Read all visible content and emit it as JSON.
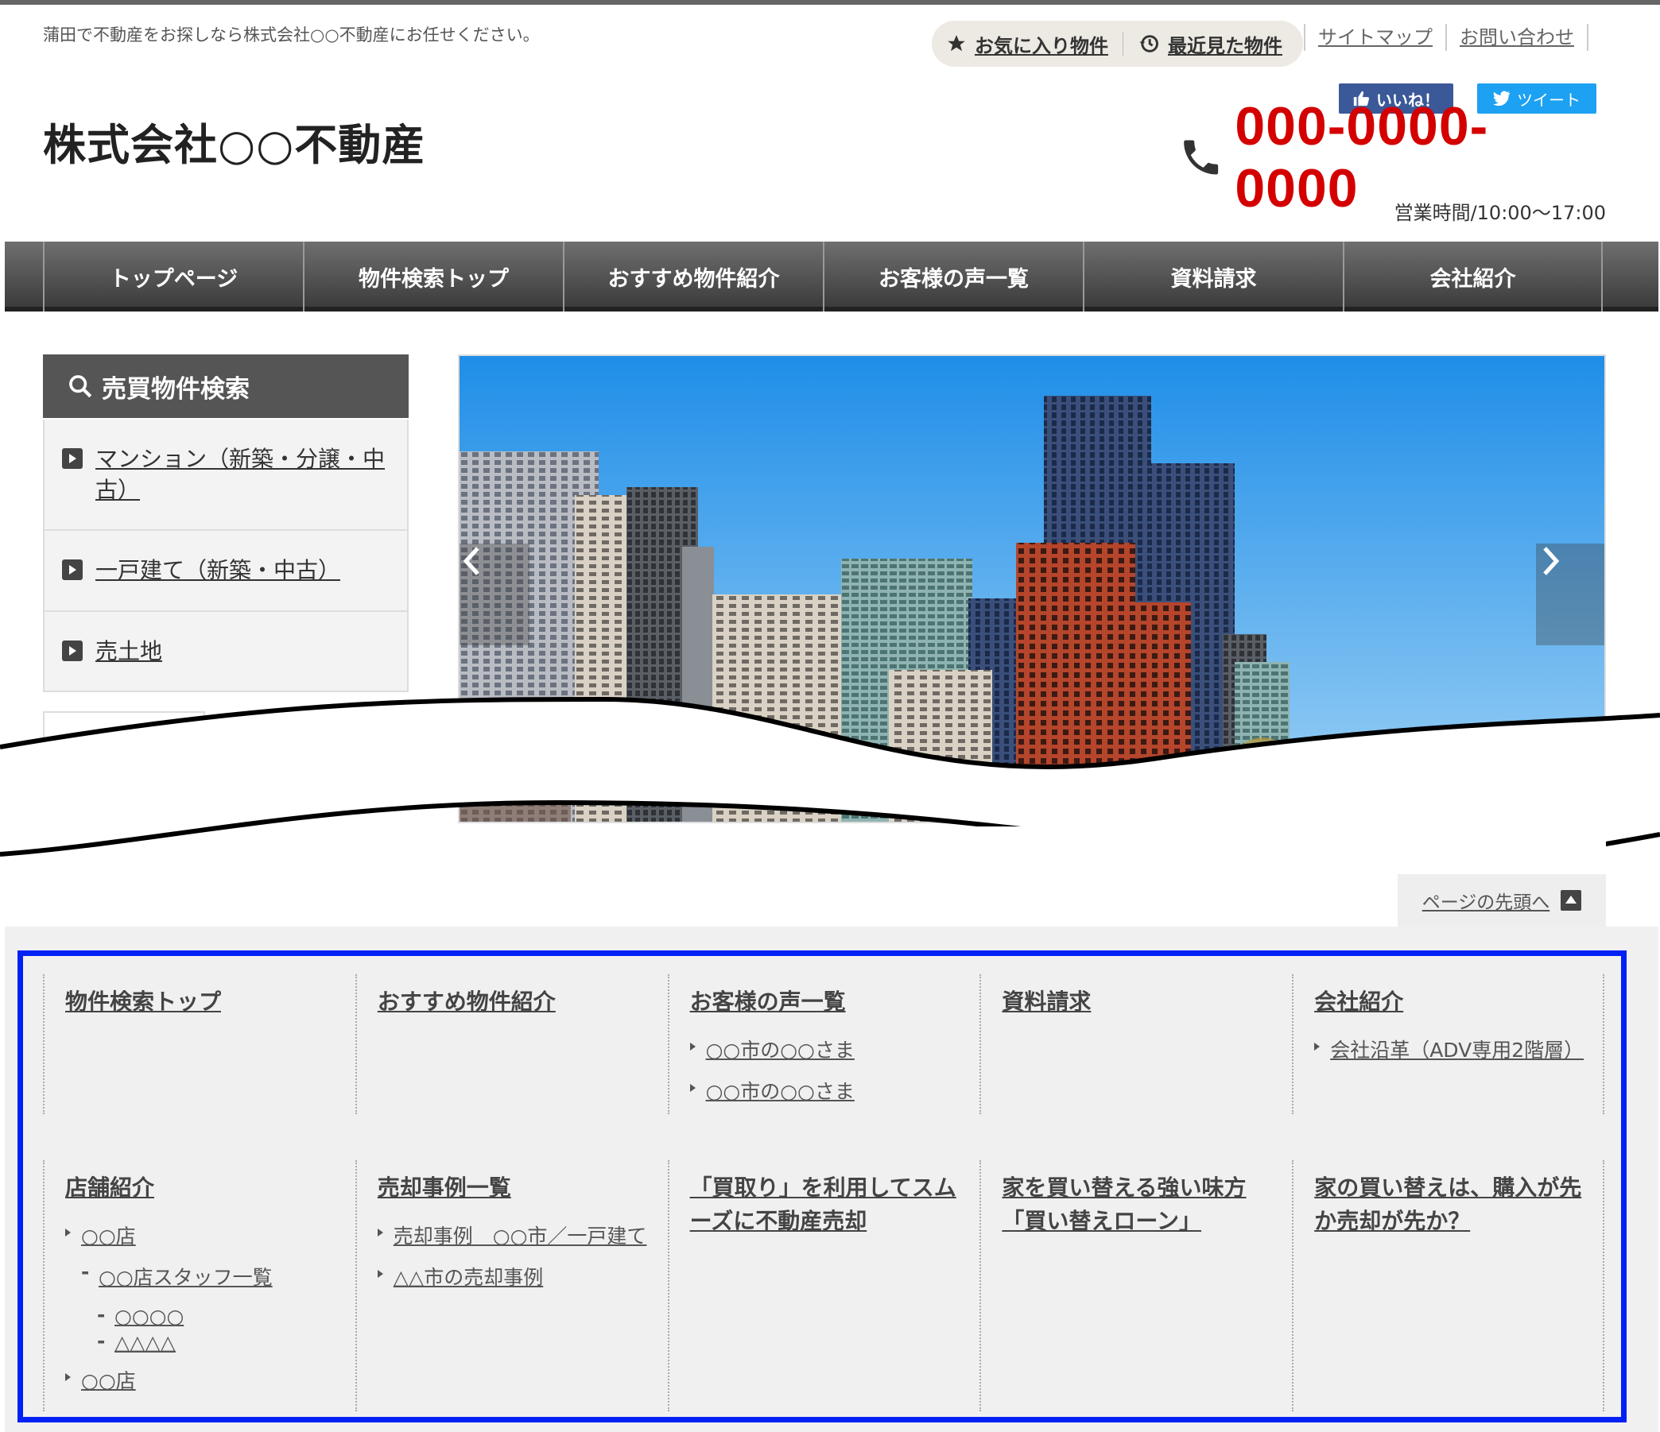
{
  "header": {
    "tagline": "蒲田で不動産をお探しなら株式会社○○不動産にお任せください。",
    "favorites_label": "お気に入り物件",
    "recent_label": "最近見た物件",
    "sitemap_label": "サイトマップ",
    "contact_label": "お問い合わせ",
    "like_label": "いいね！",
    "tweet_label": "ツイート",
    "company_name": "株式会社○○不動産",
    "phone": "000-0000-0000",
    "hours": "営業時間/10:00～17:00"
  },
  "gnav": {
    "items": [
      "トップページ",
      "物件検索トップ",
      "おすすめ物件紹介",
      "お客様の声一覧",
      "資料請求",
      "会社紹介"
    ]
  },
  "search": {
    "title": "売買物件検索",
    "items": [
      "マンション（新築・分譲・中古）",
      "一戸建て（新築・中古）",
      "売土地"
    ]
  },
  "pagetop_label": "ページの先頭へ",
  "footer": {
    "row1": [
      {
        "title": "物件検索トップ",
        "links": []
      },
      {
        "title": "おすすめ物件紹介",
        "links": []
      },
      {
        "title": "お客様の声一覧",
        "links": [
          "○○市の○○さま",
          "○○市の○○さま"
        ]
      },
      {
        "title": "資料請求",
        "links": []
      },
      {
        "title": "会社紹介",
        "links": [
          "会社沿革（ADV専用2階層）"
        ]
      }
    ],
    "row2": {
      "stores": {
        "title": "店舗紹介",
        "store1": "○○店",
        "staff": "○○店スタッフ一覧",
        "staff_a": "○○○○",
        "staff_b": "△△△△",
        "store2": "○○店"
      },
      "sales": {
        "title": "売却事例一覧",
        "links": [
          "売却事例　○○市／一戸建て",
          "△△市の売却事例"
        ]
      },
      "col3": "「買取り」を利用してスムーズに不動産売却",
      "col4": "家を買い替える強い味方「買い替えローン」",
      "col5": "家の買い替えは、購入が先か売却が先か？"
    }
  },
  "colors": {
    "accent_red": "#d40000",
    "frame_blue": "#0021f5",
    "nav_dark": "#3c3c3c"
  }
}
